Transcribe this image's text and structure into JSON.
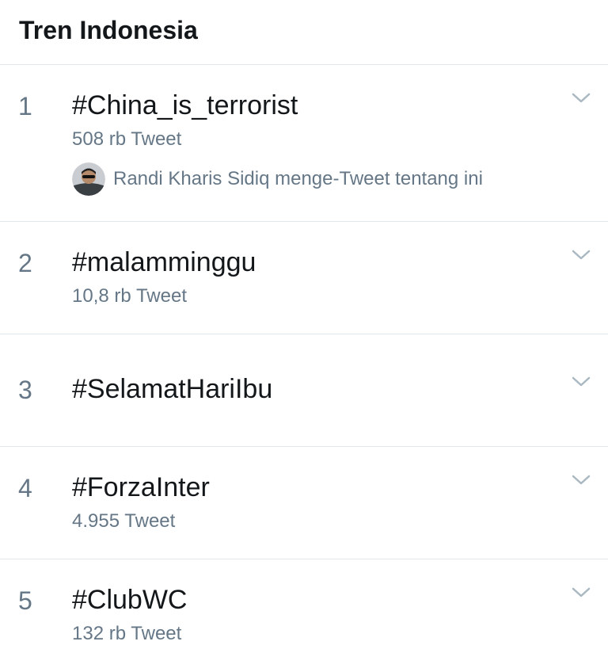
{
  "header": {
    "title": "Tren Indonesia"
  },
  "trends": [
    {
      "rank": "1",
      "hashtag": "#China_is_terrorist",
      "count": "508 rb Tweet",
      "context": "Randi Kharis Sidiq menge-Tweet tentang ini"
    },
    {
      "rank": "2",
      "hashtag": "#malamminggu",
      "count": "10,8 rb Tweet"
    },
    {
      "rank": "3",
      "hashtag": "#SelamatHariIbu"
    },
    {
      "rank": "4",
      "hashtag": "#ForzaInter",
      "count": "4.955 Tweet"
    },
    {
      "rank": "5",
      "hashtag": "#ClubWC",
      "count": "132 rb Tweet"
    }
  ],
  "icons": {
    "more": "chevron-down-icon",
    "avatar": "user-avatar"
  },
  "colors": {
    "text_primary": "#14171a",
    "text_secondary": "#657786",
    "divider": "#e1e8ed",
    "chevron": "#aab8c2"
  }
}
